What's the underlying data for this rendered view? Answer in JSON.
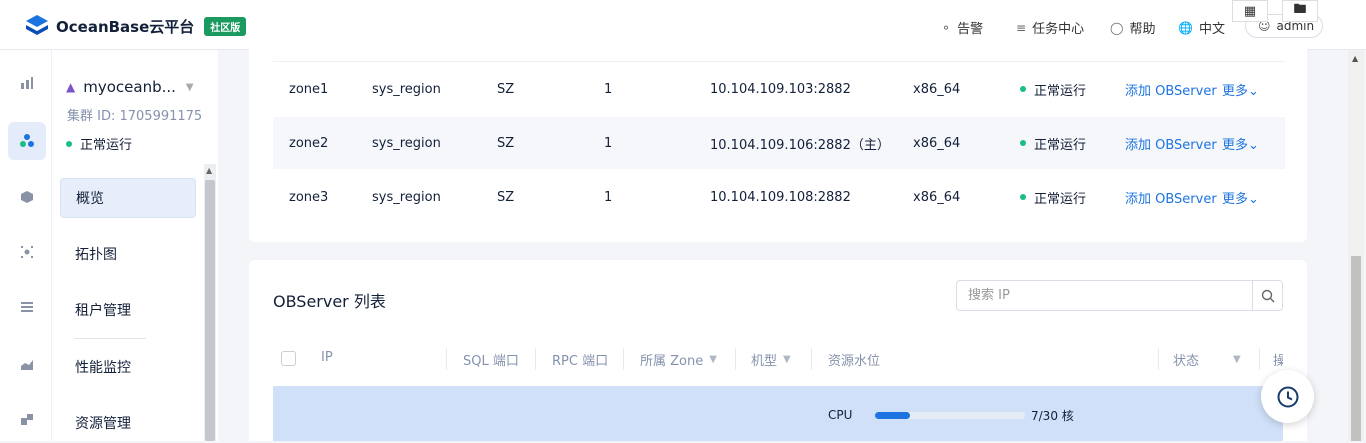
{
  "header": {
    "brand": "OceanBase云平台",
    "badge": "社区版",
    "nav": [
      {
        "label": "告警",
        "icon": "bell-icon"
      },
      {
        "label": "任务中心",
        "icon": "list-icon"
      },
      {
        "label": "帮助",
        "icon": "lightbulb-icon"
      },
      {
        "label": "中文",
        "icon": "globe-icon"
      }
    ],
    "user": "admin"
  },
  "window_buttons": [
    {
      "icon": "grid-icon"
    },
    {
      "icon": "folder-icon"
    }
  ],
  "cluster": {
    "name": "myoceanb...",
    "id": "集群 ID: 1705991175",
    "status": "正常运行"
  },
  "rail": [
    {
      "icon": "bar-chart-icon"
    },
    {
      "icon": "cluster-icon",
      "active": true
    },
    {
      "icon": "hexagon-icon"
    },
    {
      "icon": "focus-icon"
    },
    {
      "icon": "stack-icon"
    },
    {
      "icon": "area-chart-icon"
    },
    {
      "icon": "blocks-icon"
    }
  ],
  "menu": [
    {
      "label": "概览",
      "active": true
    },
    {
      "label": "拓扑图"
    },
    {
      "label": "租户管理"
    },
    {
      "label": "性能监控"
    },
    {
      "label": "资源管理"
    }
  ],
  "zones": [
    {
      "zone": "zone1",
      "region": "sys_region",
      "idc": "SZ",
      "count": "1",
      "root": "10.104.109.103:2882",
      "arch": "x86_64",
      "status": "正常运行",
      "add": "添加 OBServer",
      "more": "更多"
    },
    {
      "zone": "zone2",
      "region": "sys_region",
      "idc": "SZ",
      "count": "1",
      "root": "10.104.109.106:2882（主）",
      "arch": "x86_64",
      "status": "正常运行",
      "add": "添加 OBServer",
      "more": "更多"
    },
    {
      "zone": "zone3",
      "region": "sys_region",
      "idc": "SZ",
      "count": "1",
      "root": "10.104.109.108:2882",
      "arch": "x86_64",
      "status": "正常运行",
      "add": "添加 OBServer",
      "more": "更多"
    }
  ],
  "observer": {
    "title": "OBServer 列表",
    "search_placeholder": "搜索 IP",
    "columns": [
      "IP",
      "SQL 端口",
      "RPC 端口",
      "所属 Zone",
      "机型",
      "资源水位",
      "状态",
      "操"
    ],
    "row": {
      "cpu_label": "CPU",
      "cpu_value": "7/30 核",
      "cpu_fraction": 0.23
    }
  },
  "colors": {
    "accent": "#1d74e0",
    "status_ok": "#1bbd87",
    "badge": "#1b9a60",
    "selected_row": "#cfe0f8"
  }
}
